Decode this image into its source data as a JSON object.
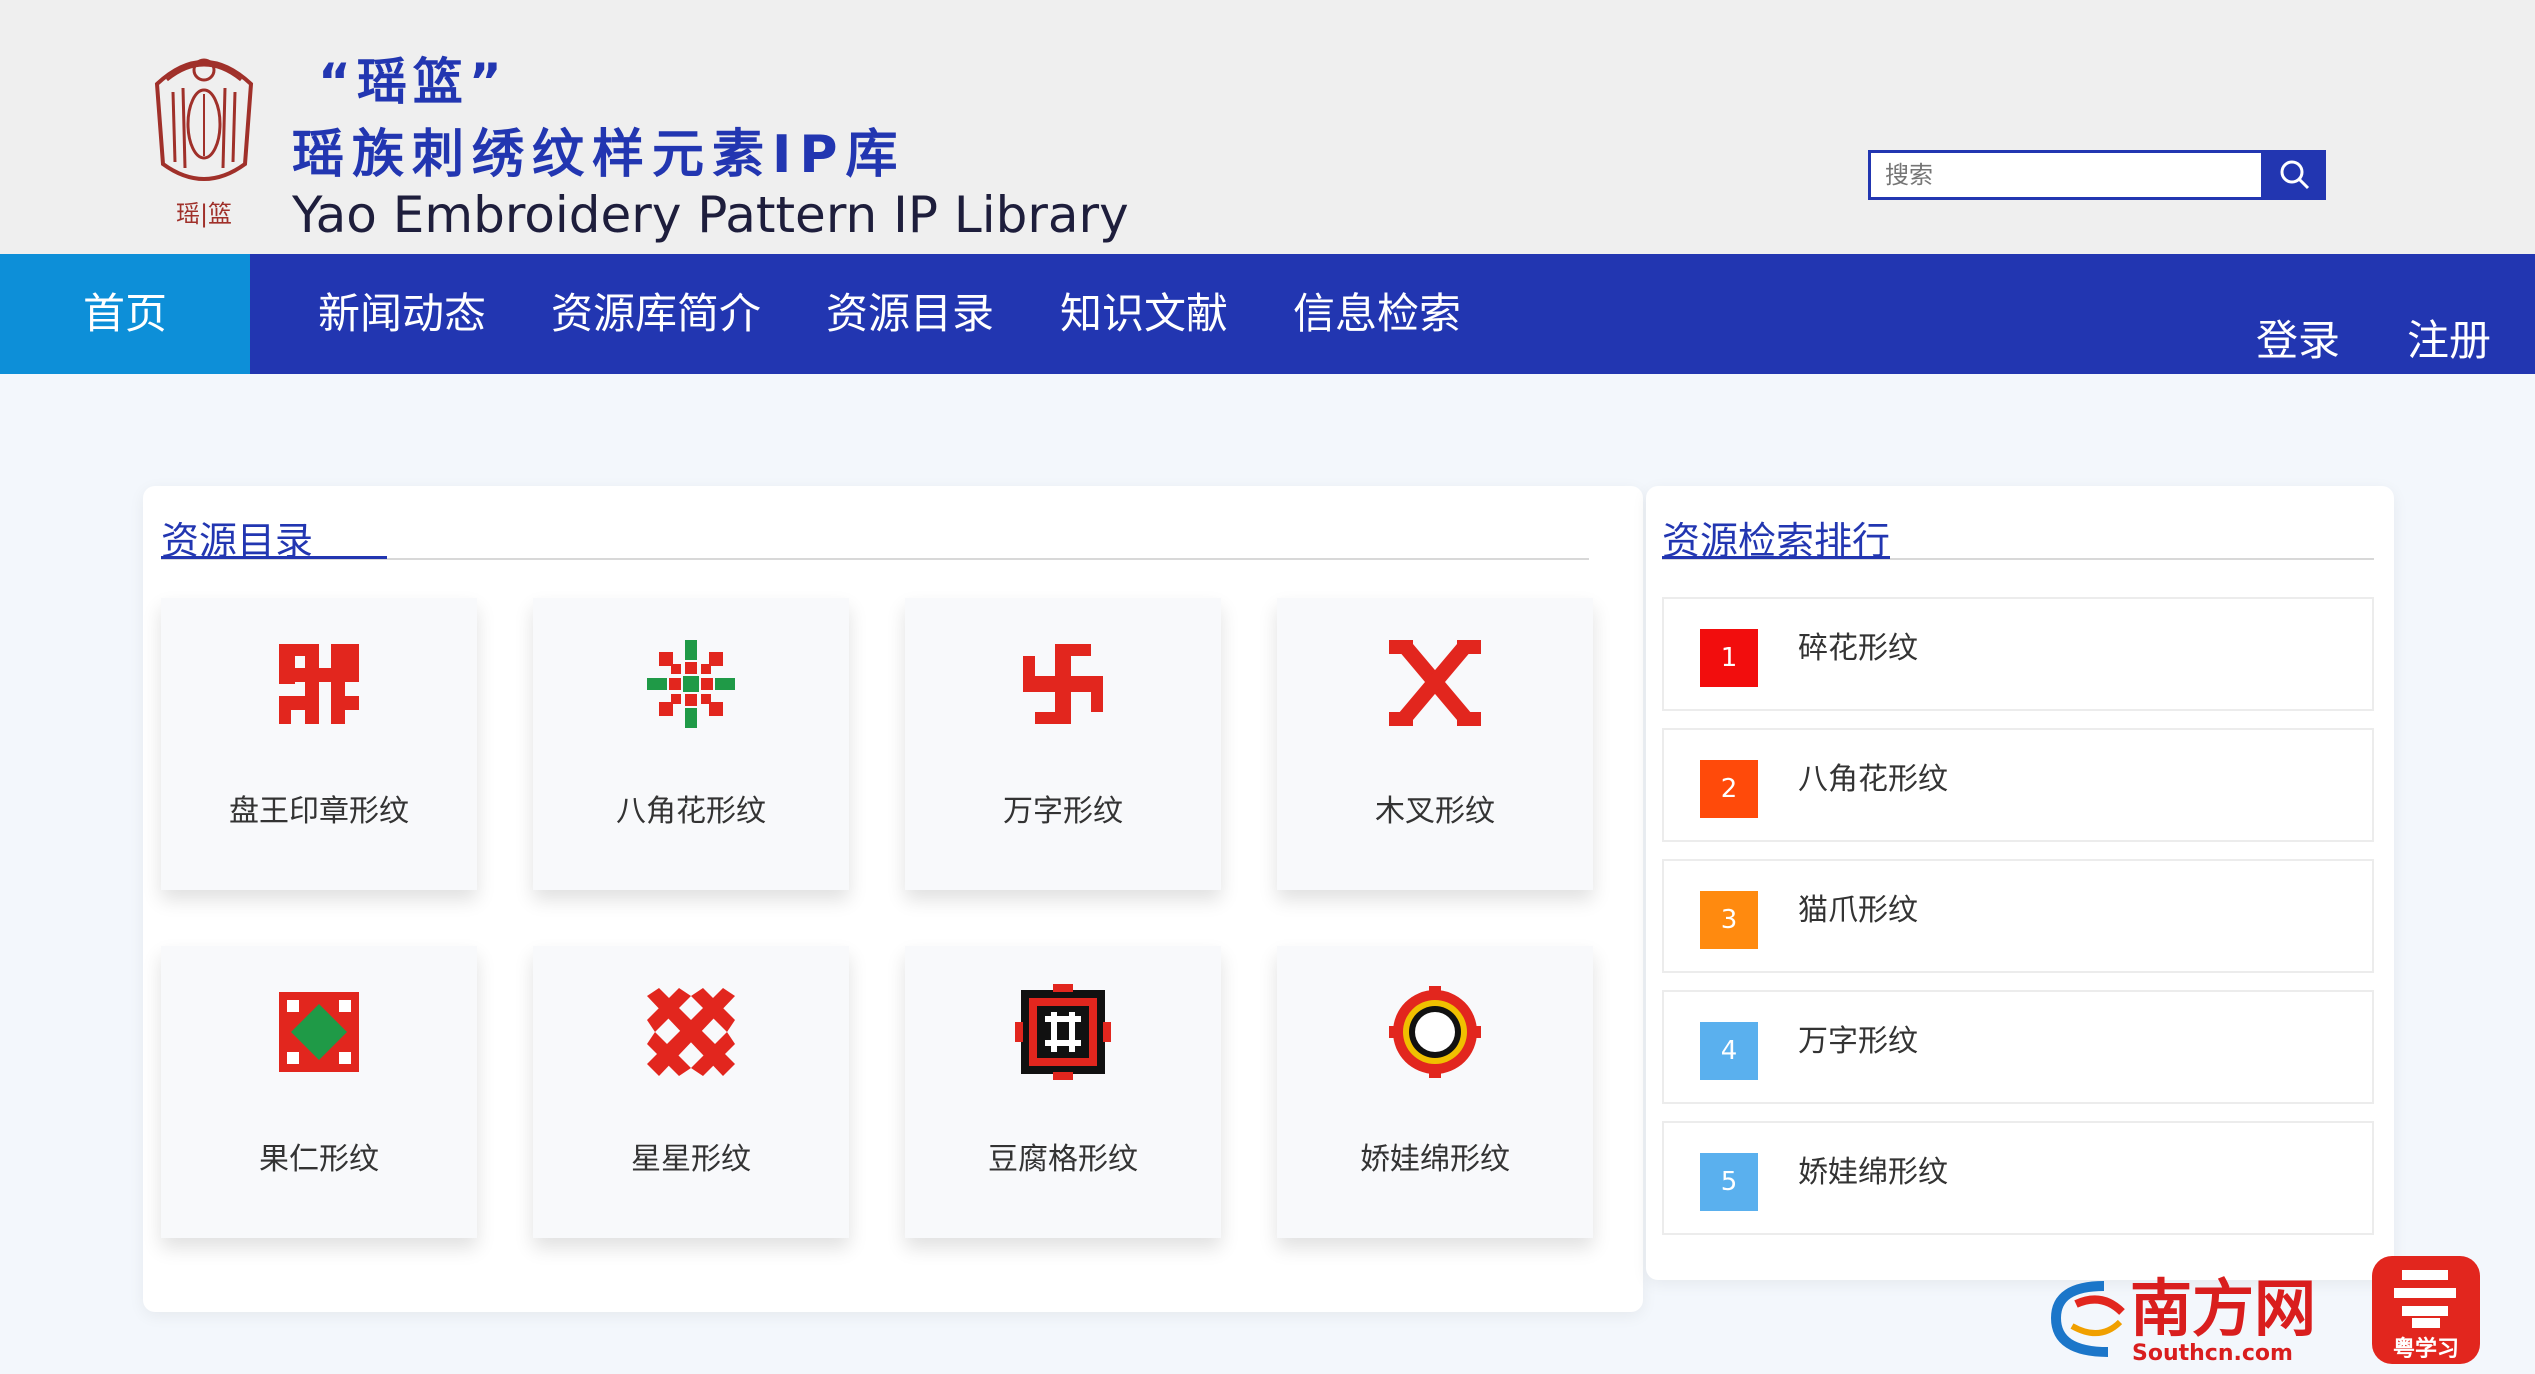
{
  "header": {
    "logo_text": "瑶|篮",
    "title_quote": "“瑶篮”",
    "title_cn": "瑶族刺绣纹样元素IP库",
    "title_en": "Yao Embroidery Pattern IP Library",
    "search_placeholder": "搜索"
  },
  "nav": {
    "items": [
      "首页",
      "新闻动态",
      "资源库简介",
      "资源目录",
      "知识文献",
      "信息检索"
    ],
    "login": "登录",
    "register": "注册"
  },
  "catalog": {
    "title": "资源目录",
    "cards": [
      {
        "label": "盘王印章形纹",
        "icon": "panwang-seal-pattern-icon"
      },
      {
        "label": "八角花形纹",
        "icon": "octagon-flower-pattern-icon"
      },
      {
        "label": "万字形纹",
        "icon": "swastika-pattern-icon"
      },
      {
        "label": "木叉形纹",
        "icon": "wooden-fork-pattern-icon"
      },
      {
        "label": "果仁形纹",
        "icon": "kernel-pattern-icon"
      },
      {
        "label": "星星形纹",
        "icon": "star-pattern-icon"
      },
      {
        "label": "豆腐格形纹",
        "icon": "tofu-grid-pattern-icon"
      },
      {
        "label": "娇娃绵形纹",
        "icon": "jiaowa-pattern-icon"
      }
    ]
  },
  "ranking": {
    "title": "资源检索排行",
    "items": [
      {
        "rank": "1",
        "label": "碎花形纹",
        "color": "#f20d0d"
      },
      {
        "rank": "2",
        "label": "八角花形纹",
        "color": "#ff4a0a"
      },
      {
        "rank": "3",
        "label": "猫爪形纹",
        "color": "#ff8a0f"
      },
      {
        "rank": "4",
        "label": "万字形纹",
        "color": "#5ab0ee"
      },
      {
        "rank": "5",
        "label": "娇娃绵形纹",
        "color": "#5ab0ee"
      }
    ]
  },
  "watermark": {
    "cn": "南方网",
    "en": "Southcn.com",
    "app": "粤学习"
  },
  "colors": {
    "primary": "#2236b1",
    "active": "#0d8fd8",
    "pattern_red": "#e2261e",
    "pattern_green": "#1f9a47"
  }
}
